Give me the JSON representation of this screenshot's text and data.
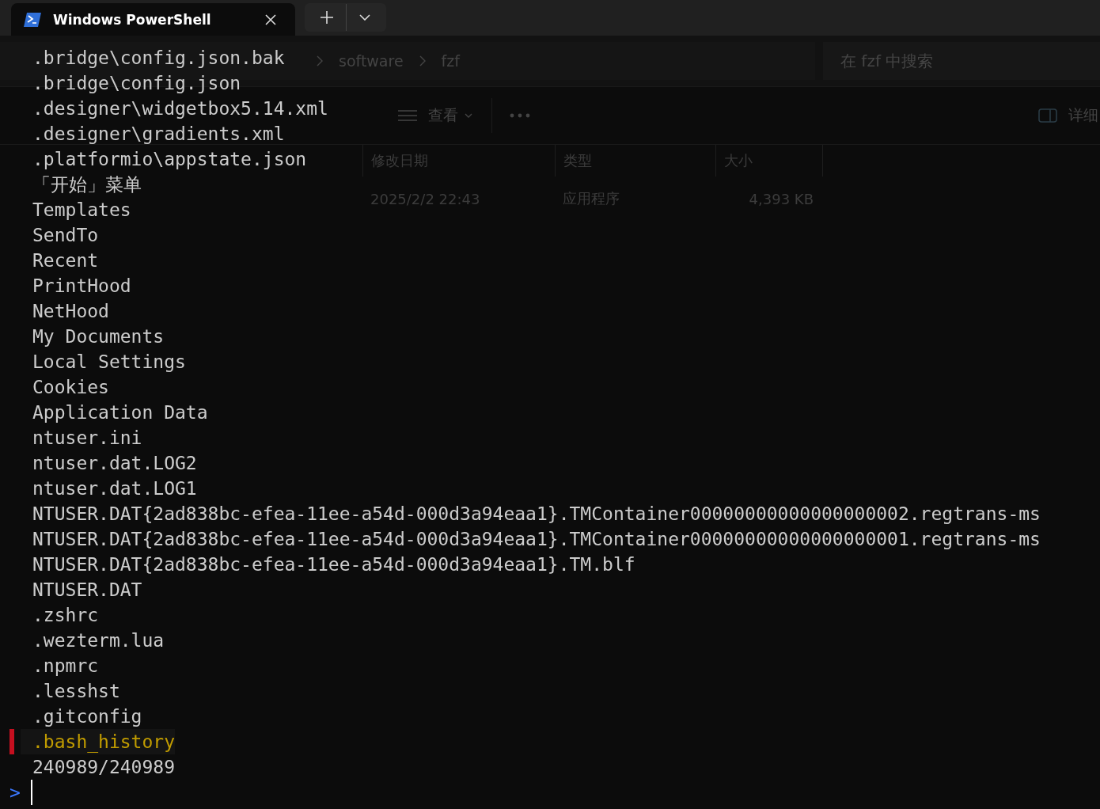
{
  "tab": {
    "title": "Windows PowerShell",
    "selected": true
  },
  "explorer": {
    "breadcrumb": [
      "software",
      "fzf"
    ],
    "search": {
      "placeholder": "在 fzf 中搜索"
    },
    "view": "查看",
    "details": "详细",
    "columns": [
      "修改日期",
      "类型",
      "大小"
    ],
    "rows": [
      {
        "date": "2025/2/2 22:43",
        "type": "应用程序",
        "size": "4,393 KB"
      }
    ]
  },
  "lines": [
    {
      "text": ".bridge\\config.json.bak",
      "selected": false
    },
    {
      "text": ".bridge\\config.json",
      "selected": false
    },
    {
      "text": ".designer\\widgetbox5.14.xml",
      "selected": false
    },
    {
      "text": ".designer\\gradients.xml",
      "selected": false
    },
    {
      "text": ".platformio\\appstate.json",
      "selected": false
    },
    {
      "text": "「开始」菜单",
      "selected": false
    },
    {
      "text": "Templates",
      "selected": false
    },
    {
      "text": "SendTo",
      "selected": false
    },
    {
      "text": "Recent",
      "selected": false
    },
    {
      "text": "PrintHood",
      "selected": false
    },
    {
      "text": "NetHood",
      "selected": false
    },
    {
      "text": "My Documents",
      "selected": false
    },
    {
      "text": "Local Settings",
      "selected": false
    },
    {
      "text": "Cookies",
      "selected": false
    },
    {
      "text": "Application Data",
      "selected": false
    },
    {
      "text": "ntuser.ini",
      "selected": false
    },
    {
      "text": "ntuser.dat.LOG2",
      "selected": false
    },
    {
      "text": "ntuser.dat.LOG1",
      "selected": false
    },
    {
      "text": "NTUSER.DAT{2ad838bc-efea-11ee-a54d-000d3a94eaa1}.TMContainer00000000000000000002.regtrans-ms",
      "selected": false
    },
    {
      "text": "NTUSER.DAT{2ad838bc-efea-11ee-a54d-000d3a94eaa1}.TMContainer00000000000000000001.regtrans-ms",
      "selected": false
    },
    {
      "text": "NTUSER.DAT{2ad838bc-efea-11ee-a54d-000d3a94eaa1}.TM.blf",
      "selected": false
    },
    {
      "text": "NTUSER.DAT",
      "selected": false
    },
    {
      "text": ".zshrc",
      "selected": false
    },
    {
      "text": ".wezterm.lua",
      "selected": false
    },
    {
      "text": ".npmrc",
      "selected": false
    },
    {
      "text": ".lesshst",
      "selected": false
    },
    {
      "text": ".gitconfig",
      "selected": false
    },
    {
      "text": ".bash_history",
      "selected": true
    }
  ],
  "count": "240989/240989",
  "prompt": ">"
}
